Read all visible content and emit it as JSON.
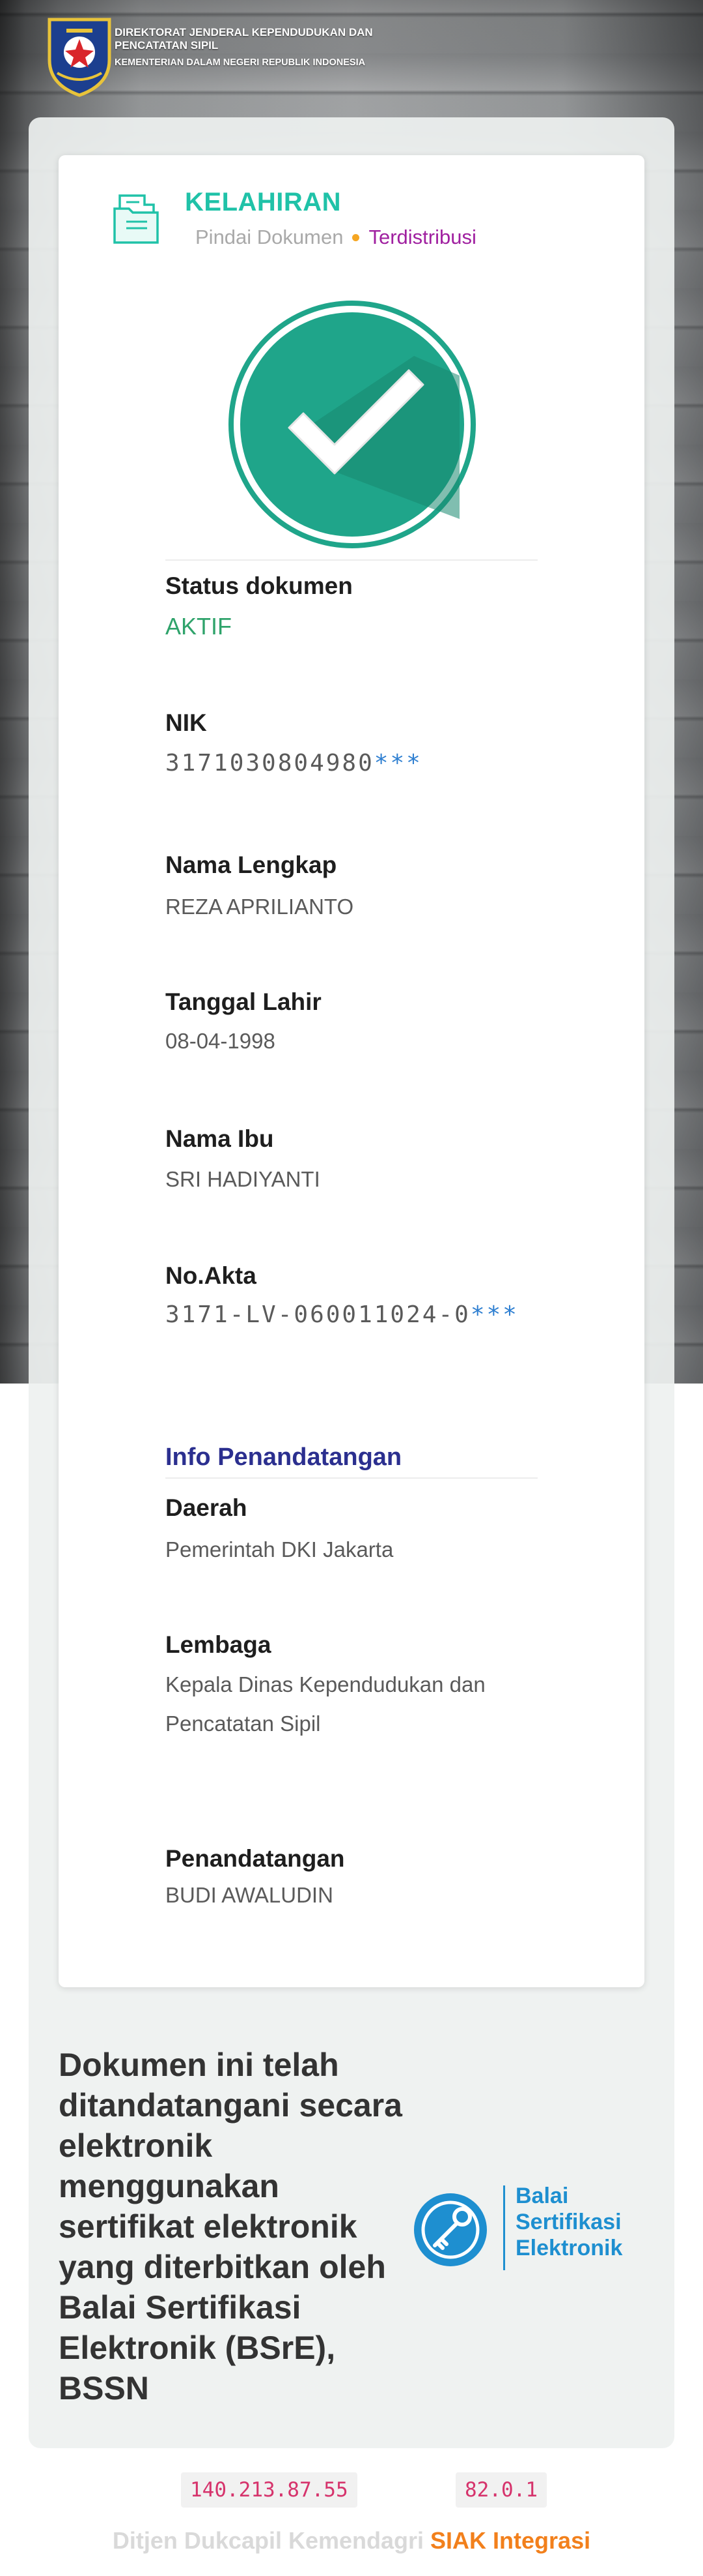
{
  "header": {
    "line1": "DIREKTORAT JENDERAL KEPENDUDUKAN DAN PENCATATAN SIPIL",
    "line2": "KEMENTERIAN DALAM NEGERI REPUBLIK INDONESIA"
  },
  "document": {
    "type": "KELAHIRAN",
    "scan_label": "Pindai Dokumen",
    "status_label": "Terdistribusi",
    "icon": "document-icon",
    "check_icon": "checkmark-icon"
  },
  "fields": {
    "status": {
      "label": "Status dokumen",
      "value": "AKTIF"
    },
    "nik": {
      "label": "NIK",
      "value": "3171030804980",
      "mask": "***"
    },
    "nama": {
      "label": "Nama Lengkap",
      "value": "REZA APRILIANTO"
    },
    "tanggal_lahir": {
      "label": "Tanggal Lahir",
      "value": "08-04-1998"
    },
    "nama_ibu": {
      "label": "Nama Ibu",
      "value": "SRI HADIYANTI"
    },
    "no_akta": {
      "label": "No.Akta",
      "value": "3171-LV-060011024-0",
      "mask": "***"
    }
  },
  "signing": {
    "title": "Info Penandatangan",
    "daerah": {
      "label": "Daerah",
      "value": "Pemerintah DKI Jakarta"
    },
    "lembaga": {
      "label": "Lembaga",
      "value": "Kepala Dinas Kependudukan dan Pencatatan Sipil"
    },
    "penandatangan": {
      "label": "Penandatangan",
      "value": "BUDI AWALUDIN"
    }
  },
  "note": "Dokumen ini telah ditandatangani secara elektronik menggunakan sertifikat elektronik yang diterbitkan oleh Balai Sertifikasi Elektronik (BSrE), BSSN",
  "bsre": {
    "line1": "Balai",
    "line2": "Sertifikasi",
    "line3": "Elektronik",
    "icon": "bsre-key-icon"
  },
  "footer": {
    "ip": "140.213.87.55",
    "version": "82.0.1",
    "org": "Ditjen Dukcapil Kemendagri",
    "app": "SIAK Integrasi"
  },
  "colors": {
    "accent": "#20c2a8",
    "check_circle": "#1fa58a",
    "status_active": "#2fa36b",
    "distributed": "#a020a0",
    "section_title": "#2b2f8f",
    "bsre": "#1e8fd0",
    "footer_app": "#f2801c"
  }
}
